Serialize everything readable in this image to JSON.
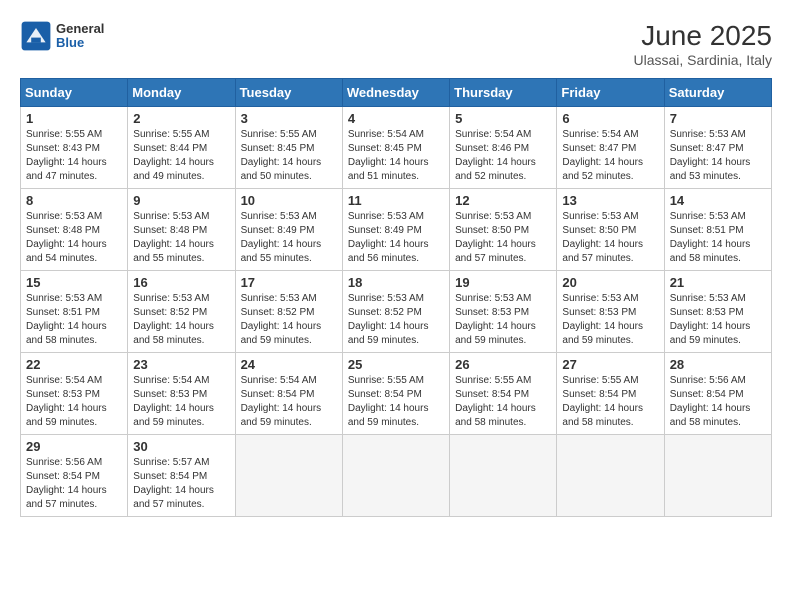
{
  "header": {
    "logo_general": "General",
    "logo_blue": "Blue",
    "month_title": "June 2025",
    "location": "Ulassai, Sardinia, Italy"
  },
  "weekdays": [
    "Sunday",
    "Monday",
    "Tuesday",
    "Wednesday",
    "Thursday",
    "Friday",
    "Saturday"
  ],
  "weeks": [
    [
      {
        "day": "1",
        "sunrise": "5:55 AM",
        "sunset": "8:43 PM",
        "daylight": "14 hours and 47 minutes."
      },
      {
        "day": "2",
        "sunrise": "5:55 AM",
        "sunset": "8:44 PM",
        "daylight": "14 hours and 49 minutes."
      },
      {
        "day": "3",
        "sunrise": "5:55 AM",
        "sunset": "8:45 PM",
        "daylight": "14 hours and 50 minutes."
      },
      {
        "day": "4",
        "sunrise": "5:54 AM",
        "sunset": "8:45 PM",
        "daylight": "14 hours and 51 minutes."
      },
      {
        "day": "5",
        "sunrise": "5:54 AM",
        "sunset": "8:46 PM",
        "daylight": "14 hours and 52 minutes."
      },
      {
        "day": "6",
        "sunrise": "5:54 AM",
        "sunset": "8:47 PM",
        "daylight": "14 hours and 52 minutes."
      },
      {
        "day": "7",
        "sunrise": "5:53 AM",
        "sunset": "8:47 PM",
        "daylight": "14 hours and 53 minutes."
      }
    ],
    [
      {
        "day": "8",
        "sunrise": "5:53 AM",
        "sunset": "8:48 PM",
        "daylight": "14 hours and 54 minutes."
      },
      {
        "day": "9",
        "sunrise": "5:53 AM",
        "sunset": "8:48 PM",
        "daylight": "14 hours and 55 minutes."
      },
      {
        "day": "10",
        "sunrise": "5:53 AM",
        "sunset": "8:49 PM",
        "daylight": "14 hours and 55 minutes."
      },
      {
        "day": "11",
        "sunrise": "5:53 AM",
        "sunset": "8:49 PM",
        "daylight": "14 hours and 56 minutes."
      },
      {
        "day": "12",
        "sunrise": "5:53 AM",
        "sunset": "8:50 PM",
        "daylight": "14 hours and 57 minutes."
      },
      {
        "day": "13",
        "sunrise": "5:53 AM",
        "sunset": "8:50 PM",
        "daylight": "14 hours and 57 minutes."
      },
      {
        "day": "14",
        "sunrise": "5:53 AM",
        "sunset": "8:51 PM",
        "daylight": "14 hours and 58 minutes."
      }
    ],
    [
      {
        "day": "15",
        "sunrise": "5:53 AM",
        "sunset": "8:51 PM",
        "daylight": "14 hours and 58 minutes."
      },
      {
        "day": "16",
        "sunrise": "5:53 AM",
        "sunset": "8:52 PM",
        "daylight": "14 hours and 58 minutes."
      },
      {
        "day": "17",
        "sunrise": "5:53 AM",
        "sunset": "8:52 PM",
        "daylight": "14 hours and 59 minutes."
      },
      {
        "day": "18",
        "sunrise": "5:53 AM",
        "sunset": "8:52 PM",
        "daylight": "14 hours and 59 minutes."
      },
      {
        "day": "19",
        "sunrise": "5:53 AM",
        "sunset": "8:53 PM",
        "daylight": "14 hours and 59 minutes."
      },
      {
        "day": "20",
        "sunrise": "5:53 AM",
        "sunset": "8:53 PM",
        "daylight": "14 hours and 59 minutes."
      },
      {
        "day": "21",
        "sunrise": "5:53 AM",
        "sunset": "8:53 PM",
        "daylight": "14 hours and 59 minutes."
      }
    ],
    [
      {
        "day": "22",
        "sunrise": "5:54 AM",
        "sunset": "8:53 PM",
        "daylight": "14 hours and 59 minutes."
      },
      {
        "day": "23",
        "sunrise": "5:54 AM",
        "sunset": "8:53 PM",
        "daylight": "14 hours and 59 minutes."
      },
      {
        "day": "24",
        "sunrise": "5:54 AM",
        "sunset": "8:54 PM",
        "daylight": "14 hours and 59 minutes."
      },
      {
        "day": "25",
        "sunrise": "5:55 AM",
        "sunset": "8:54 PM",
        "daylight": "14 hours and 59 minutes."
      },
      {
        "day": "26",
        "sunrise": "5:55 AM",
        "sunset": "8:54 PM",
        "daylight": "14 hours and 58 minutes."
      },
      {
        "day": "27",
        "sunrise": "5:55 AM",
        "sunset": "8:54 PM",
        "daylight": "14 hours and 58 minutes."
      },
      {
        "day": "28",
        "sunrise": "5:56 AM",
        "sunset": "8:54 PM",
        "daylight": "14 hours and 58 minutes."
      }
    ],
    [
      {
        "day": "29",
        "sunrise": "5:56 AM",
        "sunset": "8:54 PM",
        "daylight": "14 hours and 57 minutes."
      },
      {
        "day": "30",
        "sunrise": "5:57 AM",
        "sunset": "8:54 PM",
        "daylight": "14 hours and 57 minutes."
      },
      null,
      null,
      null,
      null,
      null
    ]
  ]
}
